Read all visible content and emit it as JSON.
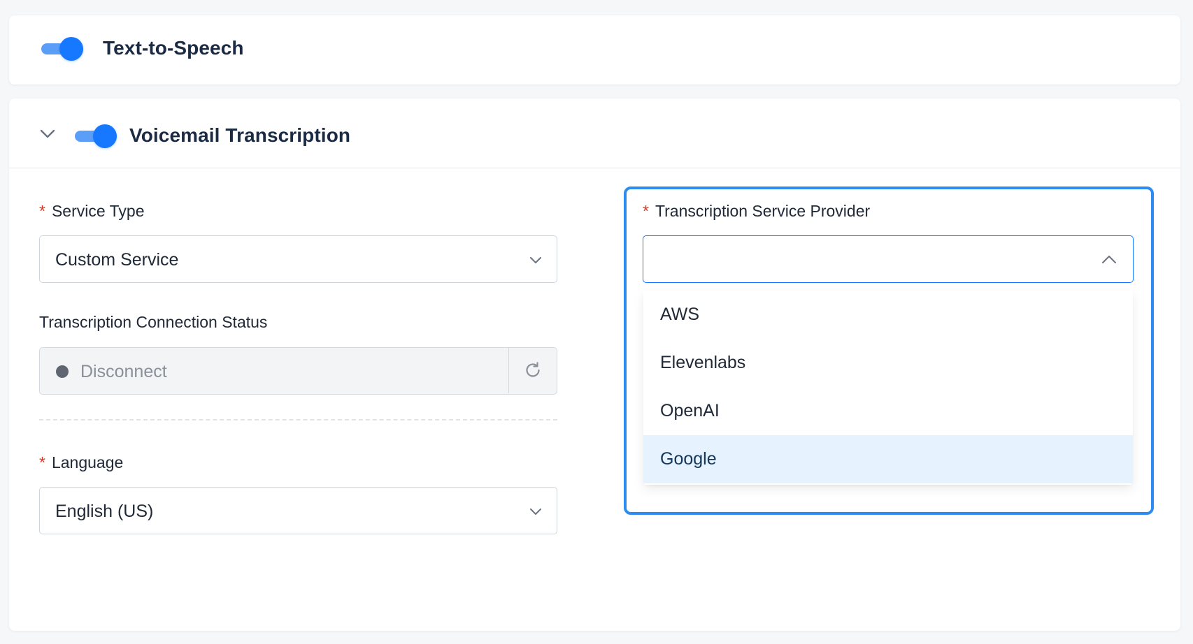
{
  "tts": {
    "title": "Text-to-Speech",
    "enabled": true
  },
  "voicemail": {
    "title": "Voicemail Transcription",
    "enabled": true,
    "expanded": true
  },
  "service_type": {
    "required_mark": "*",
    "label": "Service Type",
    "value": "Custom Service"
  },
  "connection_status": {
    "label": "Transcription Connection Status",
    "value": "Disconnect"
  },
  "language": {
    "required_mark": "*",
    "label": "Language",
    "value": "English (US)"
  },
  "provider": {
    "required_mark": "*",
    "label": "Transcription Service Provider",
    "value": "",
    "open": true,
    "options": [
      "AWS",
      "Elevenlabs",
      "OpenAI",
      "Google"
    ],
    "highlighted": "Google"
  },
  "colors": {
    "primary": "#1677ff",
    "focus_border": "#2d8cf0",
    "required": "#e5341d",
    "highlight": "#e6f2fd",
    "status_dot": "#5f6672"
  },
  "icons": {
    "collapse": "chevron-down-icon",
    "select": "chevron-down-icon",
    "dropdown_open": "chevron-up-icon",
    "refresh": "refresh-icon",
    "status": "status-dot-icon"
  }
}
